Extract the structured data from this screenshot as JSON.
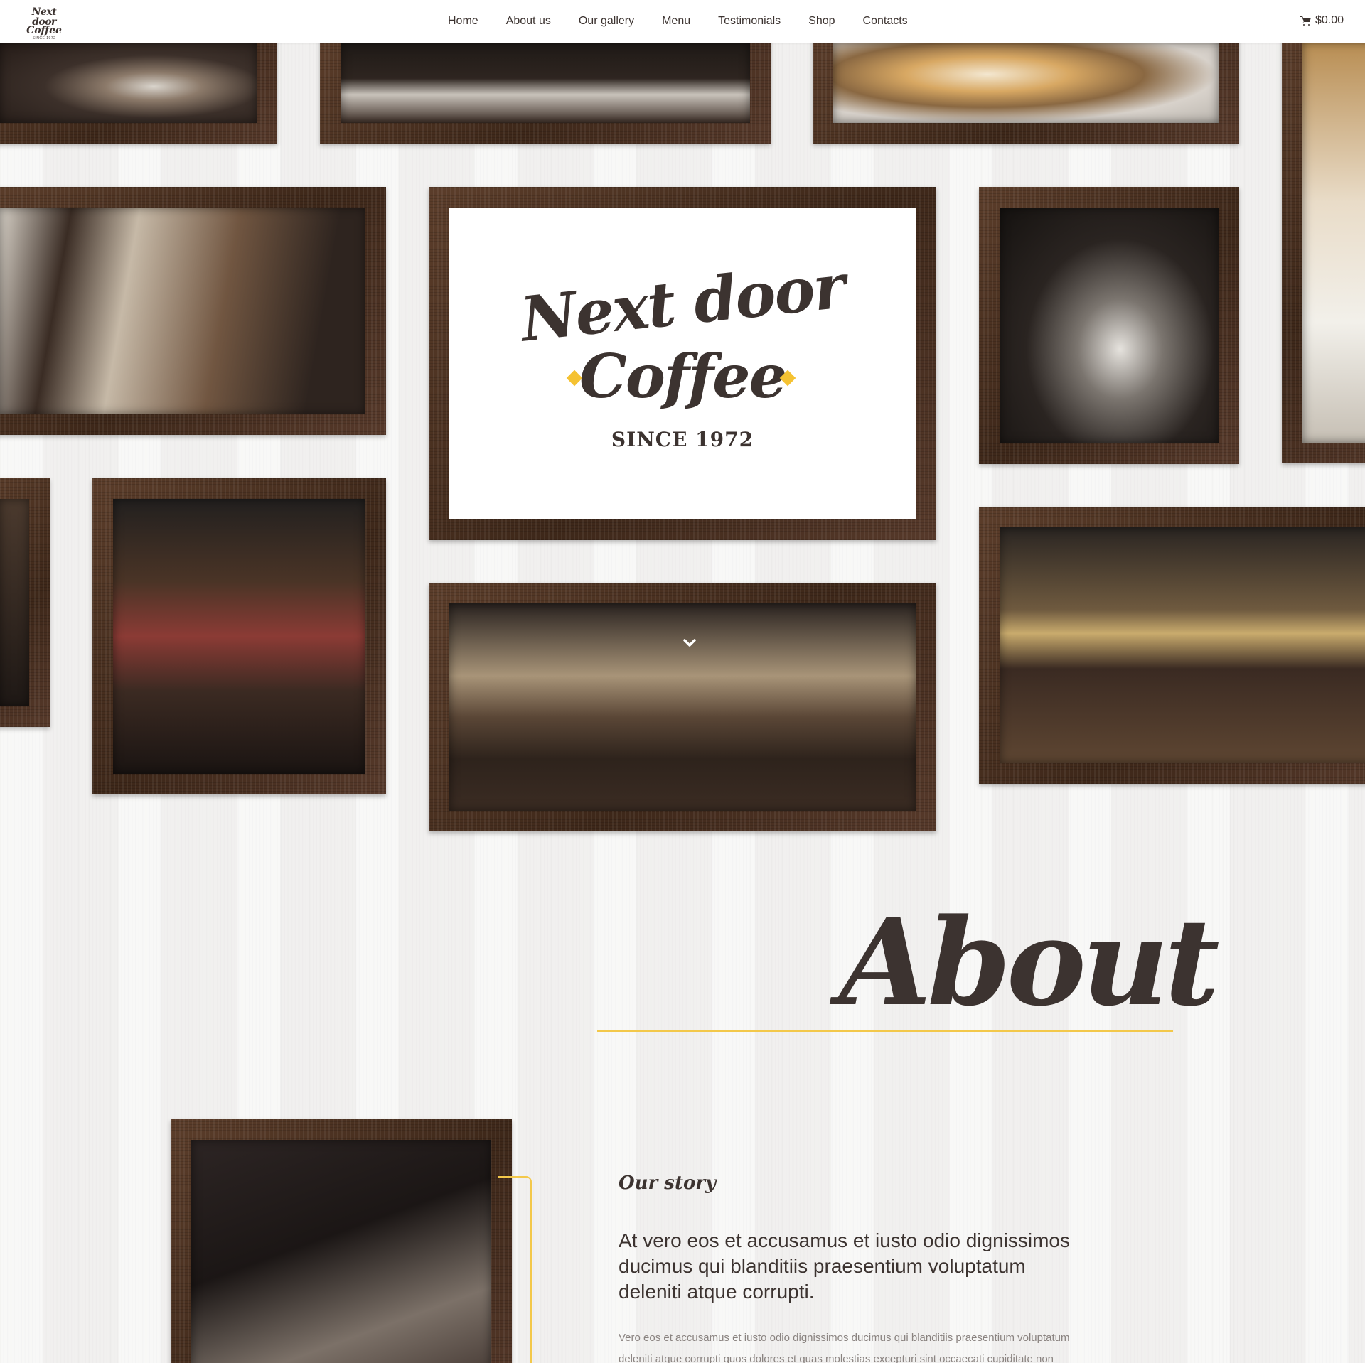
{
  "header": {
    "logo": {
      "line1": "Next door",
      "line2": "Coffee",
      "line3": "SINCE 1972"
    },
    "nav": [
      "Home",
      "About us",
      "Our gallery",
      "Menu",
      "Testimonials",
      "Shop",
      "Contacts"
    ],
    "cart_total": "$0.00"
  },
  "hero": {
    "logo_line1": "Next door",
    "logo_line2": "Coffee",
    "logo_since": "SINCE 1972",
    "accent_color": "#f5c232"
  },
  "about": {
    "title": "About",
    "story_heading": "Our story",
    "lead": "At vero eos et accusamus et iusto odio dignissimos ducimus qui blanditiis praesentium voluptatum deleniti atque corrupti.",
    "body": "Vero eos et accusamus et iusto odio dignissimos ducimus qui blanditiis praesentium voluptatum deleniti atque corrupti quos dolores et quas molestias excepturi sint occaecati cupiditate non",
    "accent_color": "#f3c84a"
  },
  "colors": {
    "text": "#3c3330",
    "frame": "#4e3323",
    "header_bg": "#ffffff"
  }
}
